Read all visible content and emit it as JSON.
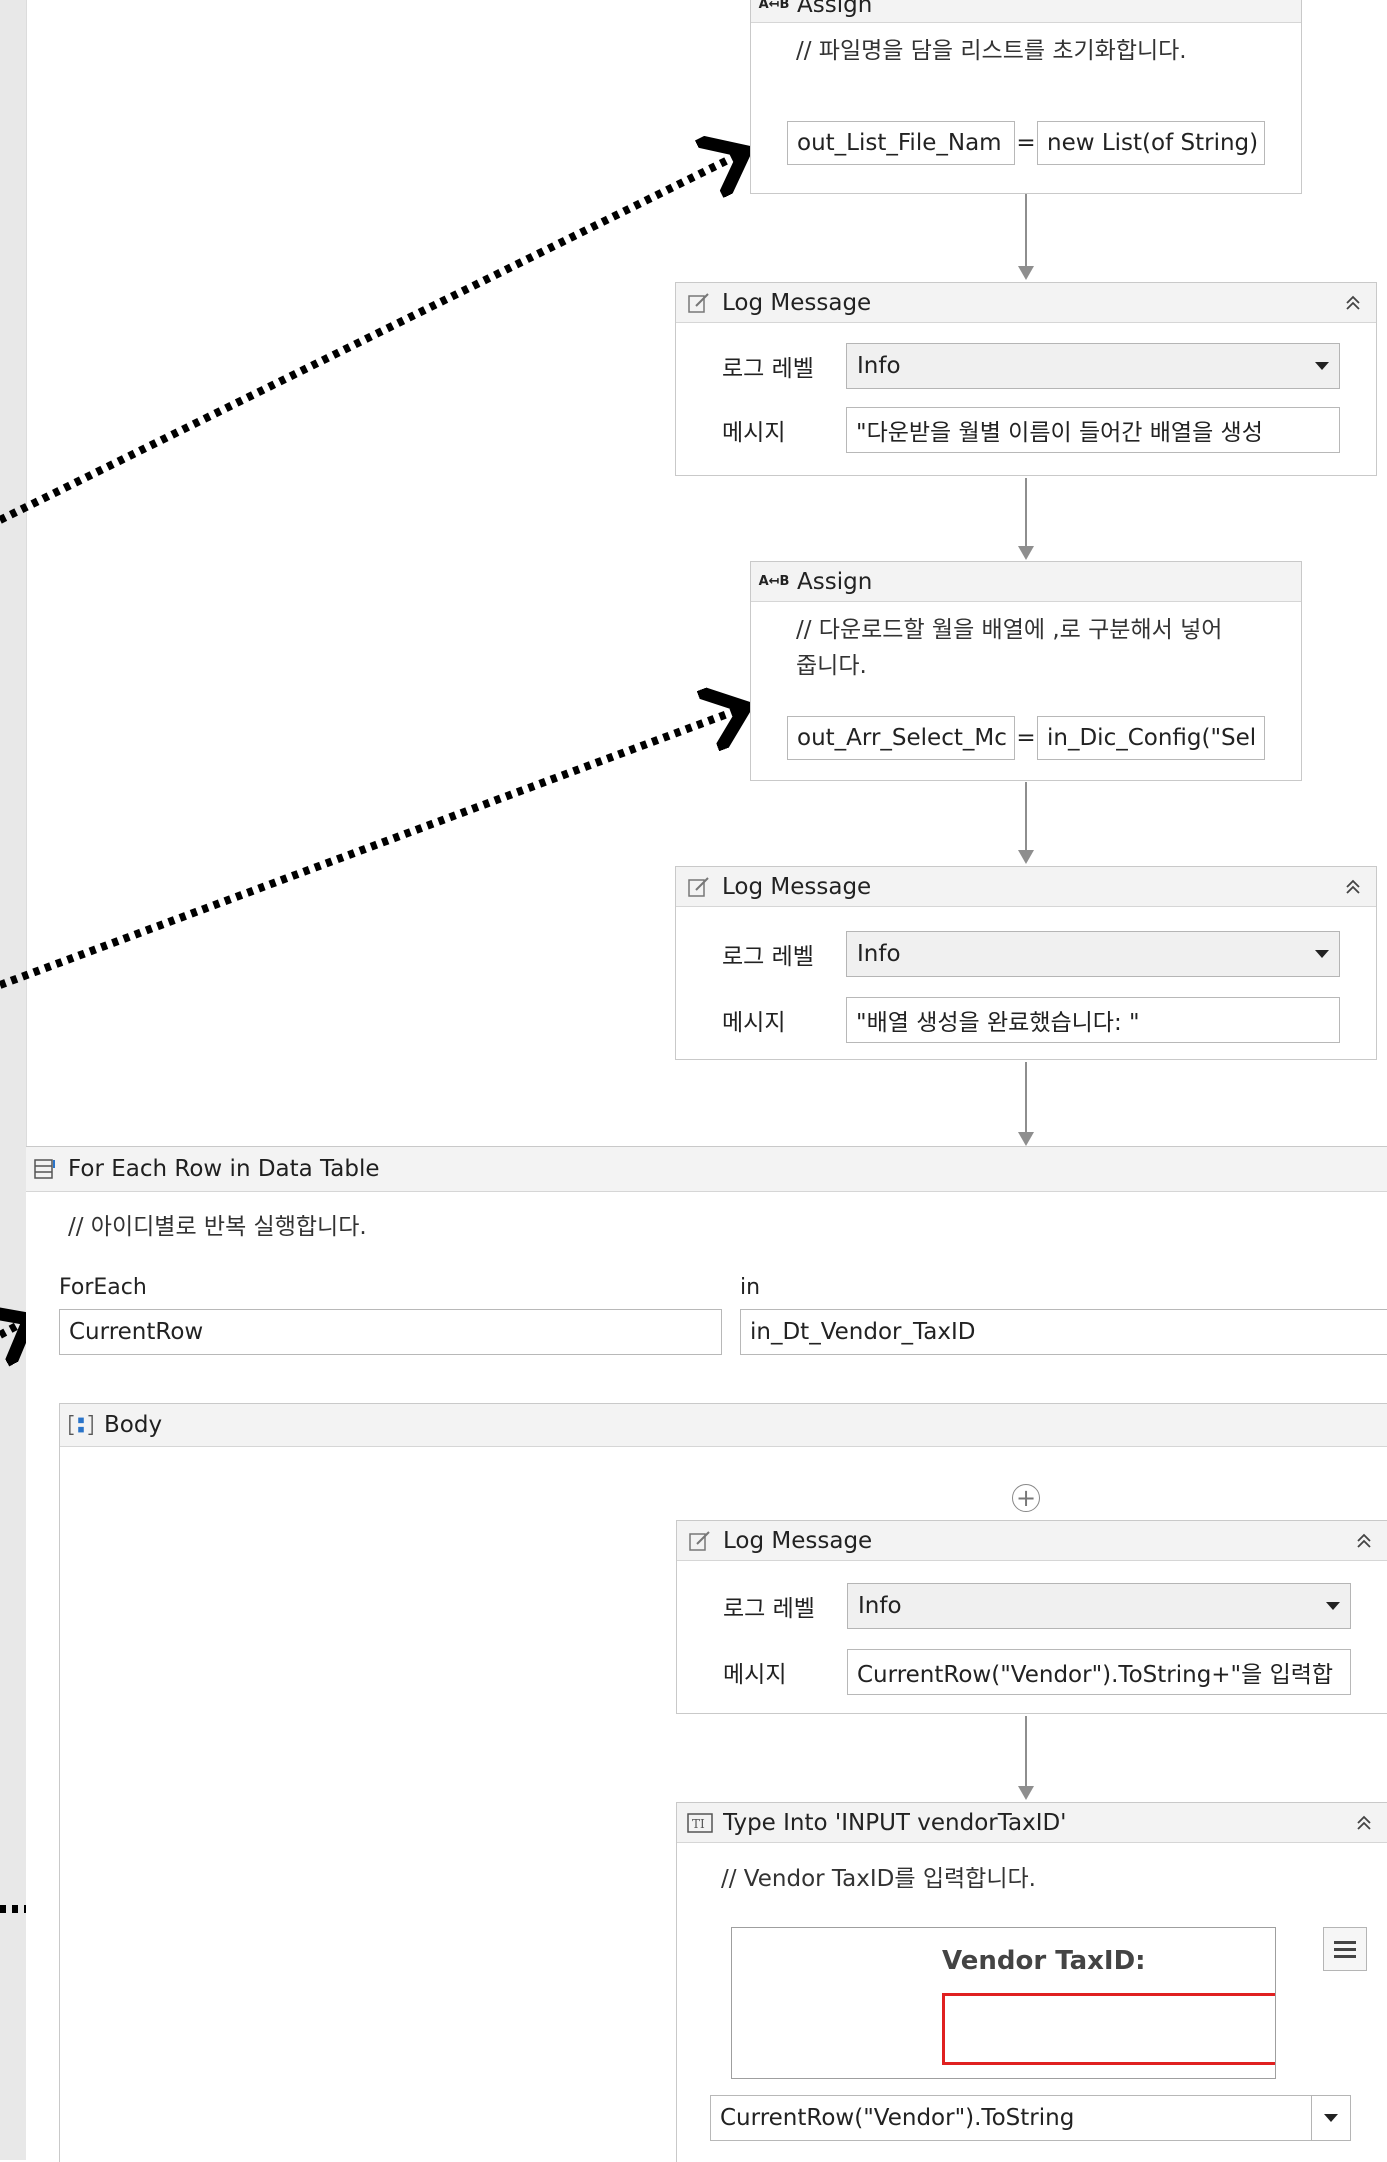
{
  "activities": {
    "assign1": {
      "title": "Assign",
      "icon": "assign-icon",
      "comment": "// 파일명을 담을 리스트를 초기화합니다.",
      "to": "out_List_File_Nam",
      "value": "new List(of String)"
    },
    "log1": {
      "title": "Log Message",
      "icon": "log-message-icon",
      "level_label": "로그 레벨",
      "level_value": "Info",
      "message_label": "메시지",
      "message_value": "\"다운받을 월별 이름이 들어간 배열을 생성"
    },
    "assign2": {
      "title": "Assign",
      "icon": "assign-icon",
      "comment": "// 다운로드할 월을 배열에 ,로 구분해서 넣어줍니다.",
      "to": "out_Arr_Select_Mc",
      "value": "in_Dic_Config(\"Sel"
    },
    "log2": {
      "title": "Log Message",
      "icon": "log-message-icon",
      "level_label": "로그 레벨",
      "level_value": "Info",
      "message_label": "메시지",
      "message_value": "\"배열 생성을 완료했습니다: \""
    },
    "foreach": {
      "title": "For Each Row in Data Table",
      "icon": "for-each-row-icon",
      "comment": "// 아이디별로 반복 실행합니다.",
      "foreach_label": "ForEach",
      "foreach_value": "CurrentRow",
      "in_label": "in",
      "in_value": "in_Dt_Vendor_TaxID",
      "body_title": "Body",
      "body_icon": "sequence-body-icon"
    },
    "log3": {
      "title": "Log Message",
      "icon": "log-message-icon",
      "level_label": "로그 레벨",
      "level_value": "Info",
      "message_label": "메시지",
      "message_value": "CurrentRow(\"Vendor\").ToString+\"을 입력합"
    },
    "typeinto": {
      "title": "Type Into 'INPUT  vendorTaxID'",
      "icon": "type-into-icon",
      "comment": "// Vendor TaxID를 입력합니다.",
      "preview_label": "Vendor TaxID:",
      "text_value": "CurrentRow(\"Vendor\").ToString"
    }
  },
  "colors": {
    "highlight_border": "#e02020",
    "header_bg": "#f3f3f3",
    "connector": "#8e8e8e"
  }
}
